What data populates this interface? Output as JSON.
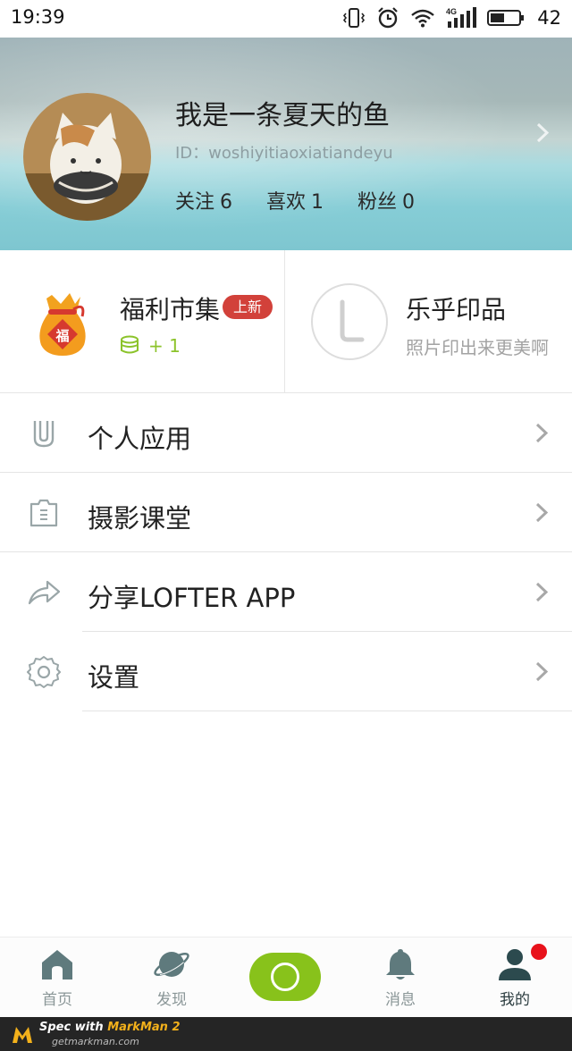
{
  "status_bar": {
    "time": "19:39",
    "battery_level": "42",
    "icons": [
      "vibrate-icon",
      "alarm-icon",
      "wifi-icon",
      "4g-signal-icon",
      "battery-icon"
    ]
  },
  "profile": {
    "name": "我是一条夏天的鱼",
    "id": "ID：woshiyitiaoxiatiandeyu",
    "stats": [
      {
        "label": "关注",
        "value": "6"
      },
      {
        "label": "喜欢",
        "value": "1"
      },
      {
        "label": "粉丝",
        "value": "0"
      }
    ]
  },
  "promos": {
    "left": {
      "title": "福利市集",
      "badge": "上新",
      "coin_text": "+ 1",
      "icon": "lucky-bag-icon"
    },
    "right": {
      "title": "乐乎印品",
      "subtitle": "照片印出来更美啊",
      "icon": "lofter-print-logo"
    }
  },
  "menu": [
    {
      "label": "个人应用",
      "icon": "apps-icon"
    },
    {
      "label": "摄影课堂",
      "icon": "camera-class-icon"
    },
    {
      "label": "分享LOFTER APP",
      "icon": "share-icon"
    },
    {
      "label": "设置",
      "icon": "gear-icon"
    }
  ],
  "tabs": [
    {
      "label": "首页",
      "icon": "home-icon",
      "active": false
    },
    {
      "label": "发现",
      "icon": "planet-icon",
      "active": false
    },
    {
      "label": "消息",
      "icon": "bell-icon",
      "active": false
    },
    {
      "label": "我的",
      "icon": "user-icon",
      "active": true
    }
  ],
  "footer": {
    "line1_prefix": "Spec with ",
    "line1_brand": "MarkMan 2",
    "line2": "getmarkman.com"
  },
  "colors": {
    "accent_green": "#88c21b",
    "badge_red": "#d2413a",
    "notification_red": "#e8121b",
    "icon_gray": "#5f7a7d"
  }
}
